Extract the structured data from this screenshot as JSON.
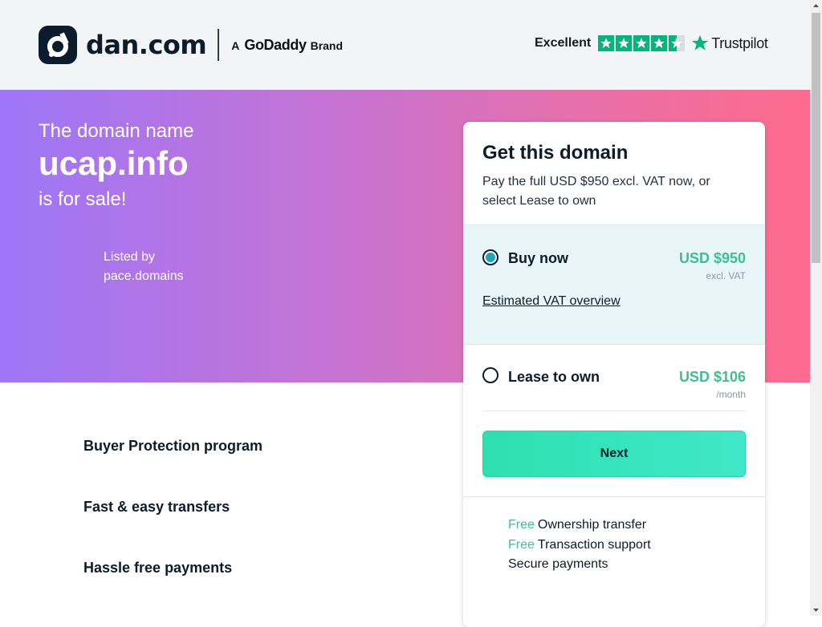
{
  "header": {
    "logo_text": "dan.com",
    "brand_prefix": "A",
    "brand_name": "GoDaddy",
    "brand_suffix": "Brand",
    "trustpilot_rating_label": "Excellent",
    "trustpilot_stars": 4.5,
    "trustpilot_name": "Trustpilot"
  },
  "hero": {
    "line1": "The domain name",
    "domain": "ucap.info",
    "line3": "is for sale!",
    "listed_by_label": "Listed by",
    "seller": "pace.domains"
  },
  "features": [
    "Buyer Protection program",
    "Fast & easy transfers",
    "Hassle free payments"
  ],
  "card": {
    "title": "Get this domain",
    "subtitle": "Pay the full USD $950 excl. VAT now, or select Lease to own",
    "buy_now": {
      "label": "Buy now",
      "price": "USD $950",
      "note": "excl. VAT",
      "vat_link": "Estimated VAT overview",
      "selected": true
    },
    "lease": {
      "label": "Lease to own",
      "price": "USD $106",
      "note": "/month",
      "selected": false
    },
    "next_label": "Next",
    "benefits": [
      {
        "free": "Free",
        "text": "Ownership transfer"
      },
      {
        "free": "Free",
        "text": "Transaction support"
      },
      {
        "free": "",
        "text": "Secure payments"
      }
    ]
  },
  "colors": {
    "accent_green": "#3fbf8f",
    "dark_navy": "#0b1c2c",
    "trustpilot_green": "#00b67a",
    "hero_gradient_start": "#9e76f8",
    "hero_gradient_end": "#ff6b8d"
  }
}
